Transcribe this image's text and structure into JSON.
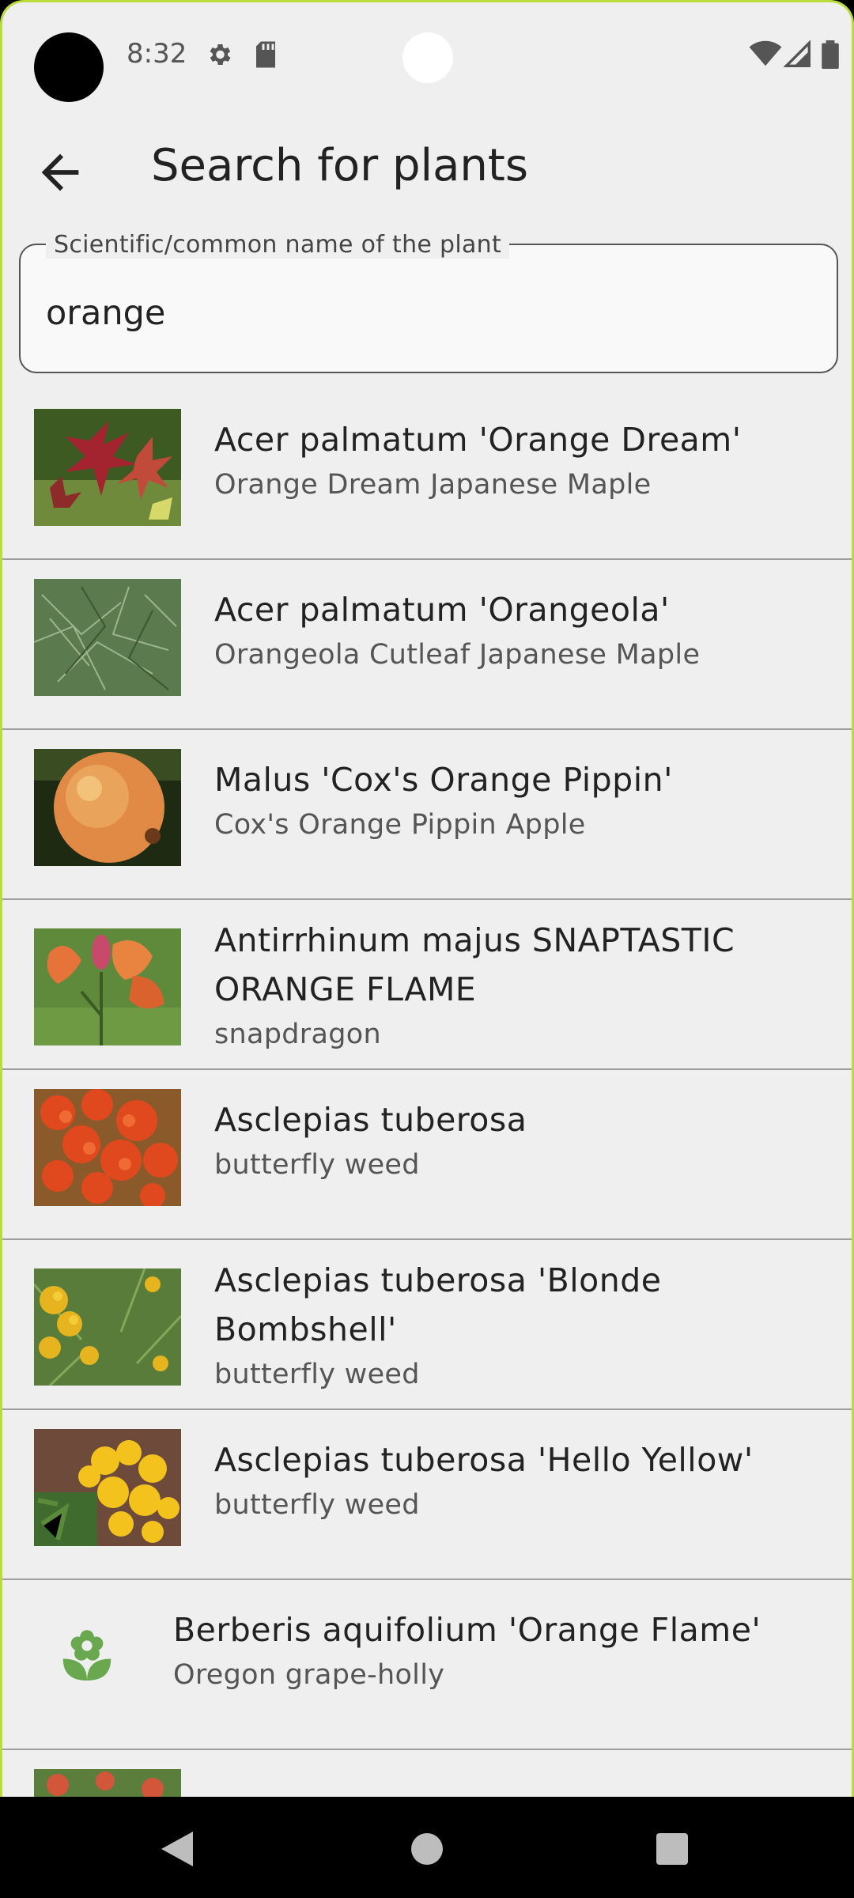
{
  "status_bar": {
    "time": "8:32",
    "left_icons": [
      "settings-icon",
      "sd-card-icon"
    ],
    "right_icons": [
      "wifi-icon",
      "signal-icon",
      "battery-icon"
    ]
  },
  "app_bar": {
    "title": "Search for plants",
    "back_icon": "arrow-left-icon"
  },
  "search": {
    "label": "Scientific/common name of the plant",
    "value": "orange"
  },
  "results": [
    {
      "scientific": "Acer palmatum 'Orange Dream'",
      "common": "Orange Dream Japanese Maple",
      "image": "red-maple-leaves"
    },
    {
      "scientific": "Acer palmatum 'Orangeola'",
      "common": "Orangeola Cutleaf Japanese Maple",
      "image": "green-cutleaf-maple"
    },
    {
      "scientific": "Malus 'Cox's Orange Pippin'",
      "common": "Cox's Orange Pippin Apple",
      "image": "apple"
    },
    {
      "scientific": "Antirrhinum majus SNAPTASTIC ORANGE FLAME",
      "common": "snapdragon",
      "image": "orange-snapdragon"
    },
    {
      "scientific": "Asclepias tuberosa",
      "common": "butterfly weed",
      "image": "orange-butterfly-weed"
    },
    {
      "scientific": "Asclepias tuberosa 'Blonde Bombshell'",
      "common": "butterfly weed",
      "image": "yellow-butterfly-weed"
    },
    {
      "scientific": "Asclepias tuberosa 'Hello Yellow'",
      "common": "butterfly weed",
      "image": "yellow-flowers"
    },
    {
      "scientific": "Berberis aquifolium 'Orange Flame'",
      "common": "Oregon grape-holly",
      "image": "flower-placeholder-icon"
    }
  ],
  "colors": {
    "accent_green": "#6aa84f",
    "device_frame": "#b9dc3a"
  },
  "nav_bar": {
    "buttons": [
      "back-triangle-icon",
      "home-circle-icon",
      "recents-square-icon"
    ]
  }
}
